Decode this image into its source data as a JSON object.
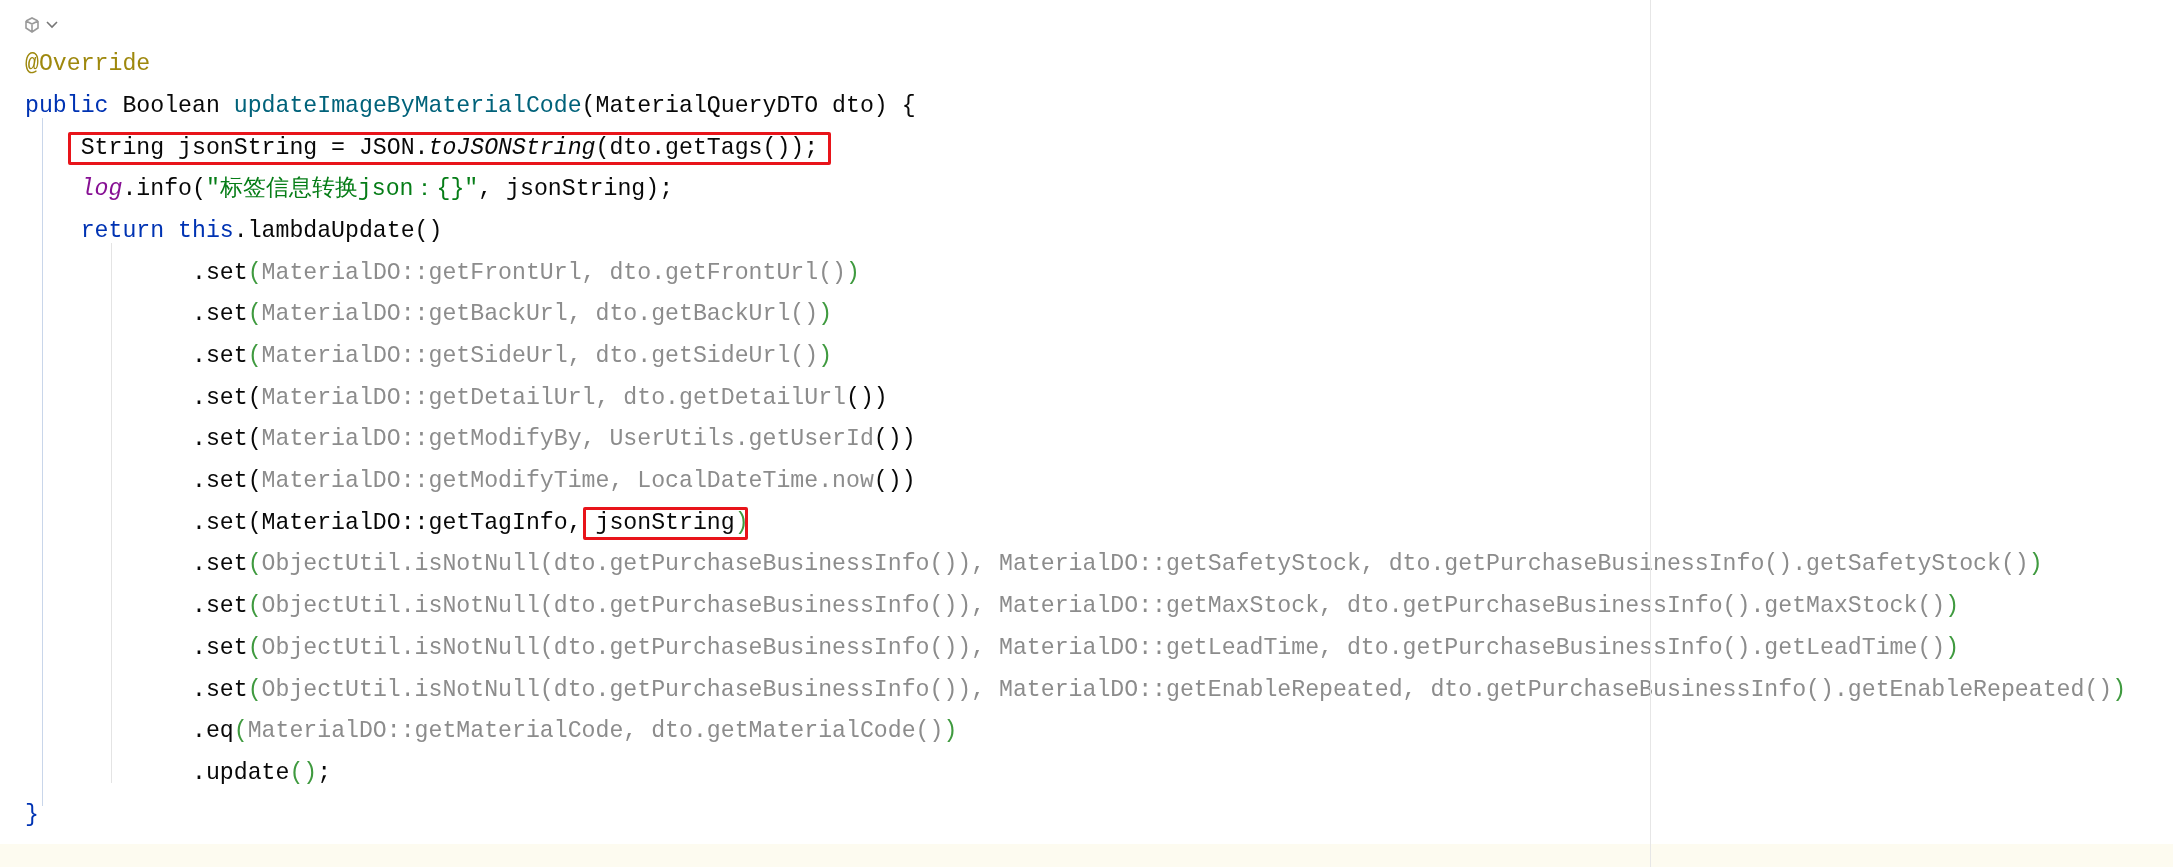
{
  "editor": {
    "lines": [
      {
        "tokens": [
          {
            "kind": "ann",
            "text": "@Override"
          }
        ]
      },
      {
        "tokens": [
          {
            "kind": "kw",
            "text": "public"
          },
          {
            "kind": "plain",
            "text": " Boolean "
          },
          {
            "kind": "decl",
            "text": "updateImageByMaterialCode"
          },
          {
            "kind": "plain",
            "text": "(MaterialQueryDTO dto) {"
          }
        ],
        "children": [
          {
            "tokens": [
              {
                "kind": "plain",
                "text": "String jsonString = JSON.",
                "boxed": true
              },
              {
                "kind": "static",
                "text": "toJSONString",
                "boxed": true
              },
              {
                "kind": "plain",
                "text": "(dto.getTags());",
                "boxed": true
              }
            ]
          },
          {
            "tokens": [
              {
                "kind": "field",
                "text": "log"
              },
              {
                "kind": "plain",
                "text": ".info("
              },
              {
                "kind": "str",
                "text": "\"标签信息转换json：{}\""
              },
              {
                "kind": "plain",
                "text": ", jsonString);"
              }
            ]
          },
          {
            "tokens": [
              {
                "kind": "kw",
                "text": "return this"
              },
              {
                "kind": "plain",
                "text": ".lambdaUpdate()"
              }
            ],
            "children": [
              {
                "tokens": [
                  {
                    "kind": "plain",
                    "text": ".set"
                  },
                  {
                    "kind": "paren",
                    "text": "("
                  },
                  {
                    "kind": "blur",
                    "text": "MaterialDO::getFrontUrl, dto.getFrontUrl()"
                  },
                  {
                    "kind": "paren",
                    "text": ")"
                  }
                ]
              },
              {
                "tokens": [
                  {
                    "kind": "plain",
                    "text": ".set"
                  },
                  {
                    "kind": "paren",
                    "text": "("
                  },
                  {
                    "kind": "blur",
                    "text": "MaterialDO::getBackUrl, dto.getBackUrl()"
                  },
                  {
                    "kind": "paren",
                    "text": ")"
                  }
                ]
              },
              {
                "tokens": [
                  {
                    "kind": "plain",
                    "text": ".set"
                  },
                  {
                    "kind": "paren",
                    "text": "("
                  },
                  {
                    "kind": "blur",
                    "text": "MaterialDO::getSideUrl, dto.getSideUrl()"
                  },
                  {
                    "kind": "paren",
                    "text": ")"
                  }
                ]
              },
              {
                "tokens": [
                  {
                    "kind": "plain",
                    "text": ".set("
                  },
                  {
                    "kind": "blur",
                    "text": "MaterialDO::getDetailUrl, dto.getDetailUrl"
                  },
                  {
                    "kind": "plain",
                    "text": "())"
                  }
                ]
              },
              {
                "tokens": [
                  {
                    "kind": "plain",
                    "text": ".set("
                  },
                  {
                    "kind": "blur",
                    "text": "MaterialDO::getModifyBy, UserUtils.getUserId"
                  },
                  {
                    "kind": "plain",
                    "text": "())"
                  }
                ]
              },
              {
                "tokens": [
                  {
                    "kind": "plain",
                    "text": ".set("
                  },
                  {
                    "kind": "blur",
                    "text": "MaterialDO::getModifyTime, LocalDateTime.now"
                  },
                  {
                    "kind": "plain",
                    "text": "())"
                  }
                ]
              },
              {
                "tokens": [
                  {
                    "kind": "plain",
                    "text": ".set(MaterialDO::getTagInfo, "
                  },
                  {
                    "kind": "plain",
                    "text": "jsonString",
                    "boxed": true
                  },
                  {
                    "kind": "paren",
                    "text": ")"
                  }
                ]
              },
              {
                "tokens": [
                  {
                    "kind": "plain",
                    "text": ".set"
                  },
                  {
                    "kind": "paren",
                    "text": "("
                  },
                  {
                    "kind": "blur",
                    "text": "ObjectUtil.isNotNull(dto.getPurchaseBusinessInfo()), MaterialDO::getSafetyStock, dto.getPurchaseBusinessInfo().getSafetyStock()"
                  },
                  {
                    "kind": "paren",
                    "text": ")"
                  }
                ]
              },
              {
                "tokens": [
                  {
                    "kind": "plain",
                    "text": ".set"
                  },
                  {
                    "kind": "paren",
                    "text": "("
                  },
                  {
                    "kind": "blur",
                    "text": "ObjectUtil.isNotNull(dto.getPurchaseBusinessInfo()), MaterialDO::getMaxStock, dto.getPurchaseBusinessInfo().getMaxStock()"
                  },
                  {
                    "kind": "paren",
                    "text": ")"
                  }
                ]
              },
              {
                "tokens": [
                  {
                    "kind": "plain",
                    "text": ".set"
                  },
                  {
                    "kind": "paren",
                    "text": "("
                  },
                  {
                    "kind": "blur",
                    "text": "ObjectUtil.isNotNull(dto.getPurchaseBusinessInfo()), MaterialDO::getLeadTime, dto.getPurchaseBusinessInfo().getLeadTime()"
                  },
                  {
                    "kind": "paren",
                    "text": ")"
                  }
                ]
              },
              {
                "tokens": [
                  {
                    "kind": "plain",
                    "text": ".set"
                  },
                  {
                    "kind": "paren",
                    "text": "("
                  },
                  {
                    "kind": "blur",
                    "text": "ObjectUtil.isNotNull(dto.getPurchaseBusinessInfo()), MaterialDO::getEnableRepeated, dto.getPurchaseBusinessInfo().getEnableRepeated()"
                  },
                  {
                    "kind": "paren",
                    "text": ")"
                  }
                ]
              },
              {
                "tokens": [
                  {
                    "kind": "plain",
                    "text": ".eq"
                  },
                  {
                    "kind": "paren",
                    "text": "("
                  },
                  {
                    "kind": "blur",
                    "text": "MaterialDO::getMaterialCode, dto.getMaterialCode()"
                  },
                  {
                    "kind": "paren",
                    "text": ")"
                  }
                ]
              },
              {
                "tokens": [
                  {
                    "kind": "plain",
                    "text": ".update"
                  },
                  {
                    "kind": "paren",
                    "text": "()"
                  },
                  {
                    "kind": "plain",
                    "text": ";"
                  }
                ]
              }
            ]
          }
        ]
      },
      {
        "tokens": [
          {
            "kind": "brace",
            "text": "}"
          }
        ]
      }
    ]
  }
}
